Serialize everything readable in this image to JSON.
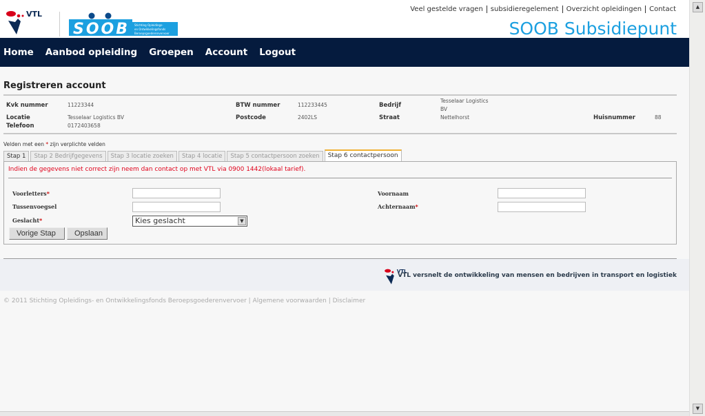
{
  "header": {
    "toplinks": [
      "Veel gestelde vragen",
      "subsidieregelement",
      "Overzicht opleidingen",
      "Contact"
    ],
    "site_title": "SOOB Subsidiepunt",
    "logo_vtl": "VTL",
    "logo_soob": "SOOB",
    "logo_soob_sub": "Stichting Opleidings- en Ontwikkelingsfonds Beroepsgoederenvervoer"
  },
  "nav": [
    "Home",
    "Aanbod opleiding",
    "Groepen",
    "Account",
    "Logout"
  ],
  "page_title": "Registreren account",
  "info": {
    "kvk_label": "Kvk nummer",
    "kvk": "11223344",
    "btw_label": "BTW nummer",
    "btw": "112233445",
    "bedrijf_label": "Bedrijf",
    "bedrijf1": "Tesselaar Logistics",
    "bedrijf2": "BV",
    "locatie_label": "Locatie",
    "locatie": "Tesselaar Logistics BV",
    "postcode_label": "Postcode",
    "postcode": "2402LS",
    "straat_label": "Straat",
    "straat": "Nettelhorst",
    "huisnummer_label": "Huisnummer",
    "huisnummer": "88",
    "telefoon_label": "Telefoon",
    "telefoon": "0172403658"
  },
  "note": {
    "pre": "Velden met een ",
    "star": "*",
    "post": " zijn verplichte velden"
  },
  "tabs": [
    "Stap 1",
    "Stap 2 Bedrijfgegevens",
    "Stap 3 locatie zoeken",
    "Stap 4 locatie",
    "Stap 5 contactpersoon zoeken",
    "Stap 6 contactpersoon"
  ],
  "form": {
    "warning": "Indien de gegevens niet correct zijn neem dan contact op met VTL via 0900 1442(lokaal tarief).",
    "voorletters": "Voorletters",
    "tussenvoegsel": "Tussenvoegsel",
    "geslacht": "Geslacht",
    "voornaam": "Voornaam",
    "achternaam": "Achternaam",
    "star": "*",
    "geslacht_value": "Kies geslacht",
    "btn_prev": "Vorige Stap",
    "btn_save": "Opslaan"
  },
  "footer": {
    "slogan": "VTL versnelt de ontwikkeling van mensen en bedrijven in transport en logistiek",
    "copyright": "© 2011 Stichting Opleidings- en Ontwikkelingsfonds Beroepsgoederenvervoer",
    "sep": " | ",
    "link1": "Algemene voorwaarden",
    "link2": "Disclaimer"
  },
  "colors": {
    "nav_bg": "#051b3e",
    "title_blue": "#1ca0e0",
    "warning_red": "#e0001a",
    "active_tab": "#f0b030"
  }
}
